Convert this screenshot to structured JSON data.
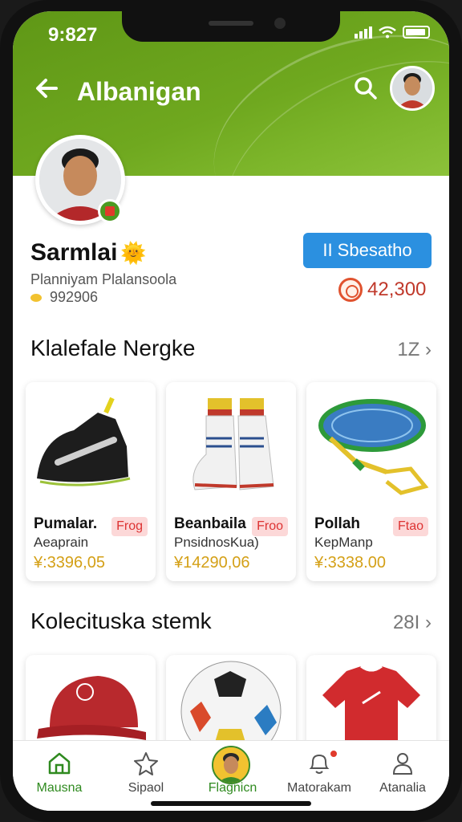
{
  "status_bar": {
    "time": "9:827"
  },
  "header": {
    "title": "Albanigan"
  },
  "profile": {
    "name": "Sarmlai",
    "subtitle": "Planniyam Plalansoola",
    "stat": "992906",
    "action_button": "II Sbesatho",
    "coins": "42,300"
  },
  "sections": [
    {
      "title": "Klalefale Nergke",
      "more": "1Z",
      "items": [
        {
          "title": "Pumalar.",
          "sub": "Aeaprain",
          "price": "¥:3396,05",
          "tag": "Frog"
        },
        {
          "title": "Beanbaila",
          "sub": "PnsidnosKua)",
          "price": "¥14290,06",
          "tag": "Froo"
        },
        {
          "title": "Pollah",
          "sub": "KepManp",
          "price": "¥:3338.00",
          "tag": "Ftao"
        }
      ]
    },
    {
      "title": "Kolecituska stemk",
      "more": "28I",
      "items": [
        {
          "icon": "cap-icon"
        },
        {
          "icon": "soccer-ball-icon"
        },
        {
          "icon": "jersey-icon"
        }
      ]
    }
  ],
  "tabbar": [
    {
      "label": "Mausna",
      "icon": "home-icon",
      "active": true
    },
    {
      "label": "Sipaol",
      "icon": "star-icon"
    },
    {
      "label": "Flagnicn",
      "icon": "avatar-icon"
    },
    {
      "label": "Matorakam",
      "icon": "bell-icon"
    },
    {
      "label": "Atanalia",
      "icon": "user-icon"
    }
  ],
  "colors": {
    "header_green": "#6fa81f",
    "accent_blue": "#2b90e0",
    "price_gold": "#d4a017",
    "coin_red": "#c0392b"
  }
}
